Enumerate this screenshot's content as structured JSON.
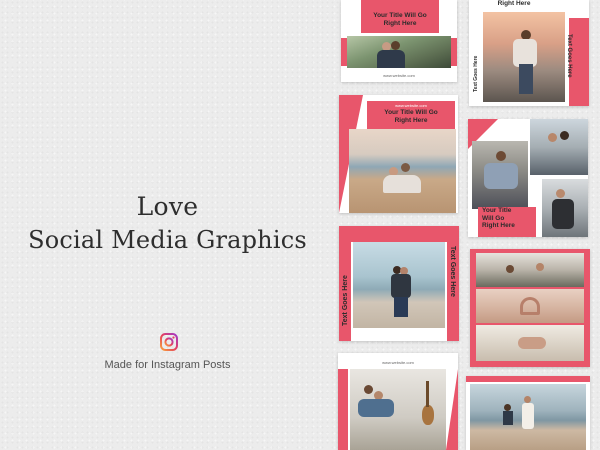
{
  "hero": {
    "title_line1": "Love",
    "title_line2": "Social Media Graphics",
    "icon": "instagram-icon",
    "subtitle": "Made for Instagram Posts"
  },
  "templates": {
    "title_text": "Your Title Will Go Right Here",
    "title_line_a": "Your Title Will Go",
    "title_line_b": "Right Here",
    "title_stack": [
      "Your Title",
      "Will Go",
      "Right Here"
    ],
    "vertical_text": "Text Goes Here",
    "url": "www.website.com"
  },
  "colors": {
    "accent": "#e8566b",
    "background": "#ececec",
    "title": "#2e2e2e"
  }
}
